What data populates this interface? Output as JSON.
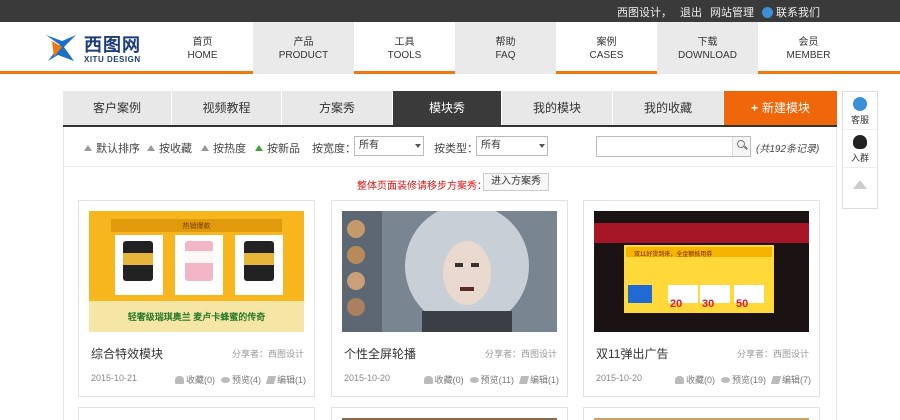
{
  "topbar": {
    "site_name": "西图设计，",
    "logout": "退出",
    "admin": "网站管理",
    "contact": "联系我们"
  },
  "logo": {
    "name": "西图网",
    "sub": "XITU DESIGN"
  },
  "nav": [
    {
      "zh": "首页",
      "en": "HOME"
    },
    {
      "zh": "产品",
      "en": "PRODUCT"
    },
    {
      "zh": "工具",
      "en": "TOOLS"
    },
    {
      "zh": "帮助",
      "en": "FAQ"
    },
    {
      "zh": "案例",
      "en": "CASES"
    },
    {
      "zh": "下载",
      "en": "DOWNLOAD"
    },
    {
      "zh": "会员",
      "en": "MEMBER"
    }
  ],
  "tabs": [
    {
      "label": "客户案例"
    },
    {
      "label": "视频教程"
    },
    {
      "label": "方案秀"
    },
    {
      "label": "模块秀",
      "active": true
    },
    {
      "label": "我的模块"
    },
    {
      "label": "我的收藏"
    },
    {
      "label": "新建模块",
      "plus": "+"
    }
  ],
  "filter": {
    "sorts": [
      "默认排序",
      "按收藏",
      "按热度",
      "按新品"
    ],
    "width_label": "按宽度：",
    "width_value": "所有",
    "type_label": "按类型：",
    "type_value": "所有",
    "search_value": "",
    "count": "(共192条记录)"
  },
  "notice": {
    "text": "整体页面装修请移步方案秀：",
    "button": "进入方案秀"
  },
  "cards": [
    {
      "title": "综合特效模块",
      "sharer": "分享者：西图设计",
      "date": "2015-10-21",
      "fav": "收藏(0)",
      "view": "预览(4)",
      "edit": "编辑(1)"
    },
    {
      "title": "个性全屏轮播",
      "sharer": "分享者：西图设计",
      "date": "2015-10-20",
      "fav": "收藏(0)",
      "view": "预览(11)",
      "edit": "编辑(1)"
    },
    {
      "title": "双11弹出广告",
      "sharer": "分享者：西图设计",
      "date": "2015-10-20",
      "fav": "收藏(0)",
      "view": "预览(19)",
      "edit": "编辑(7)"
    }
  ],
  "thumb1": {
    "header": "热销爆款",
    "caption": "轻奢级瑞琪奥兰 麦卢卡蜂蜜的传奇"
  },
  "thumb3": {
    "headline": "双11好货到来，全金额抵用券",
    "coupons": [
      "20",
      "30",
      "50"
    ]
  },
  "widget": {
    "service": "客服",
    "group": "入群"
  },
  "colors": {
    "accent": "#f0660a",
    "dark": "#3a3a3a"
  }
}
